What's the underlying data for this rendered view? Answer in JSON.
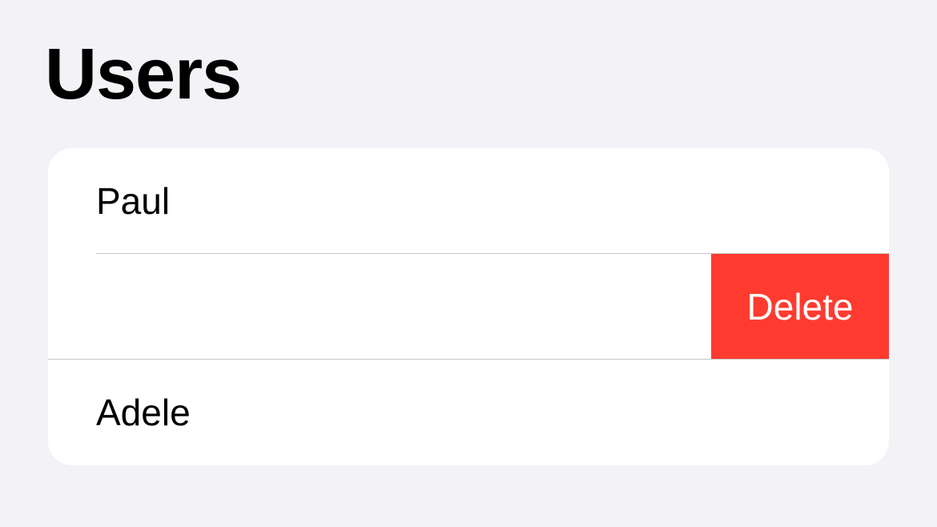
{
  "header": {
    "title": "Users"
  },
  "list": {
    "rows": [
      {
        "label": "Paul"
      },
      {
        "label": "",
        "swipe_action": "Delete"
      },
      {
        "label": "Adele"
      }
    ]
  },
  "colors": {
    "background": "#f2f2f7",
    "card": "#ffffff",
    "separator": "#c6c6c8",
    "destructive": "#ff3b30"
  }
}
